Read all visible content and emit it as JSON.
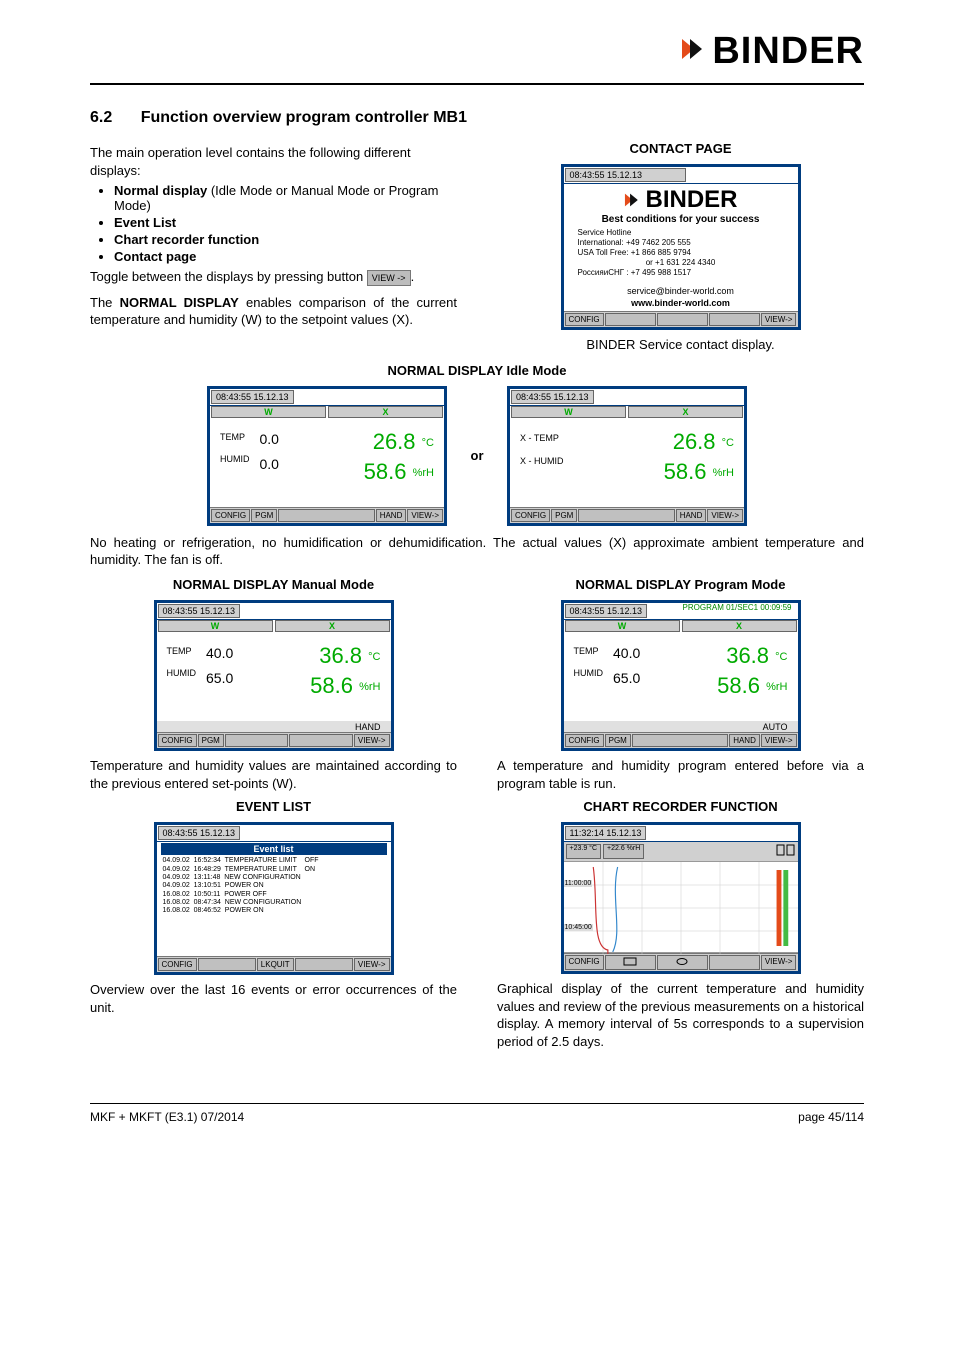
{
  "brand": "BINDER",
  "section_number": "6.2",
  "section_title": "Function overview program controller MB1",
  "intro_para": "The main operation level contains the following different displays:",
  "bullets": [
    {
      "strong": "Normal display",
      "rest": " (Idle Mode or Manual Mode or Program Mode)"
    },
    {
      "strong": "Event List",
      "rest": ""
    },
    {
      "strong": "Chart recorder function",
      "rest": ""
    },
    {
      "strong": "Contact page",
      "rest": ""
    }
  ],
  "toggle_line_a": "Toggle between the displays by pressing button ",
  "view_btn_label": "VIEW ->",
  "normal_disp_para": "The NORMAL DISPLAY enables comparison of the current temperature and humidity (W) to the setpoint values (X).",
  "contact_page_title": "CONTACT PAGE",
  "contact_caption": "BINDER Service contact display.",
  "contact": {
    "timestamp": "08:43:55  15.12.13",
    "slogan": "Best conditions for your success",
    "line1": "Service Hotline",
    "line2": "International:    +49 7462 205 555",
    "line3": "USA Toll Free: +1 866 885 9794",
    "line4": "or  +1 631 224 4340",
    "line5": "РоссияиСНГ : +7 495 988 1517",
    "email": "service@binder-world.com",
    "web": "www.binder-world.com",
    "btn_config": "CONFIG",
    "btn_view": "VIEW->"
  },
  "normal_idle_title": "NORMAL DISPLAY  Idle Mode",
  "or_text": "or",
  "idle_note": "No heating or refrigeration, no humidification or dehumidification. The actual values (X) approximate ambient temperature and humidity. The fan is off.",
  "idle_a": {
    "timestamp": "08:43:55  15.12.13",
    "W": "W",
    "X": "X",
    "lbl_temp": "TEMP",
    "lbl_humid": "HUMID",
    "w_temp": "0.0",
    "w_humid": "0.0",
    "x_temp": "26.8",
    "x_temp_u": "°C",
    "x_humid": "58.6",
    "x_humid_u": "%rH",
    "btn_config": "CONFIG",
    "btn_pgm": "PGM",
    "btn_hand": "HAND",
    "btn_view": "VIEW->"
  },
  "idle_b": {
    "timestamp": "08:43:55  15.12.13",
    "W": "W",
    "X": "X",
    "lbl_xtemp": "X - TEMP",
    "lbl_xhumid": "X - HUMID",
    "x_temp": "26.8",
    "x_temp_u": "°C",
    "x_humid": "58.6",
    "x_humid_u": "%rH",
    "btn_config": "CONFIG",
    "btn_pgm": "PGM",
    "btn_hand": "HAND",
    "btn_view": "VIEW->"
  },
  "manual_title": "NORMAL DISPLAY  Manual Mode",
  "program_title": "NORMAL DISPLAY  Program Mode",
  "manual": {
    "timestamp": "08:43:55  15.12.13",
    "W": "W",
    "X": "X",
    "lbl_temp": "TEMP",
    "lbl_humid": "HUMID",
    "w_temp": "40.0",
    "w_humid": "65.0",
    "x_temp": "36.8",
    "x_temp_u": "°C",
    "x_humid": "58.6",
    "x_humid_u": "%rH",
    "hand_row": "HAND",
    "btn_config": "CONFIG",
    "btn_pgm": "PGM",
    "btn_view": "VIEW->"
  },
  "manual_caption": "Temperature and humidity values are maintained according to the previous entered set-points (W).",
  "program": {
    "timestamp": "08:43:55  15.12.13",
    "prog_hdr": "PROGRAM 01/SEC1 00:09:59",
    "W": "W",
    "X": "X",
    "lbl_temp": "TEMP",
    "lbl_humid": "HUMID",
    "w_temp": "40.0",
    "w_humid": "65.0",
    "x_temp": "36.8",
    "x_temp_u": "°C",
    "x_humid": "58.6",
    "x_humid_u": "%rH",
    "auto_row": "AUTO",
    "btn_config": "CONFIG",
    "btn_pgm": "PGM",
    "btn_hand": "HAND",
    "btn_view": "VIEW->"
  },
  "program_caption": "A temperature and humidity program entered before via a program table is run.",
  "event_list_title": "EVENT LIST",
  "event": {
    "timestamp": "08:43:55  15.12.13",
    "hdr": "Event list",
    "rows": [
      "04.09.02  16:52:34  TEMPERATURE LIMIT    OFF",
      "04.09.02  16:48:29  TEMPERATURE LIMIT    ON",
      "04.09.02  13:11:48  NEW CONFIGURATION",
      "04.09.02  13:10:51  POWER ON",
      "16.08.02  10:50:11  POWER OFF",
      "16.08.02  08:47:34  NEW CONFIGURATION",
      "16.08.02  08:46:52  POWER ON"
    ],
    "btn_config": "CONFIG",
    "btn_lkquit": "LKQUIT",
    "btn_view": "VIEW->"
  },
  "event_caption": "Overview over the last 16 events or error occurrences of the unit.",
  "chart_title": "CHART RECORDER FUNCTION",
  "chart": {
    "timestamp": "11:32:14  15.12.13",
    "tag_a": "+23.9  °C",
    "tag_b": "+22.6 %rH",
    "time1": "11:00:00",
    "time2": "10:45:00",
    "btn_config": "CONFIG",
    "btn_view": "VIEW->"
  },
  "chart_caption": "Graphical display of the current temperature and humidity values and review of the previous measurements on a historical display. A memory interval of 5s corresponds to a supervision period of 2.5 days.",
  "footer_left": "MKF + MKFT (E3.1) 07/2014",
  "footer_right": "page 45/114"
}
